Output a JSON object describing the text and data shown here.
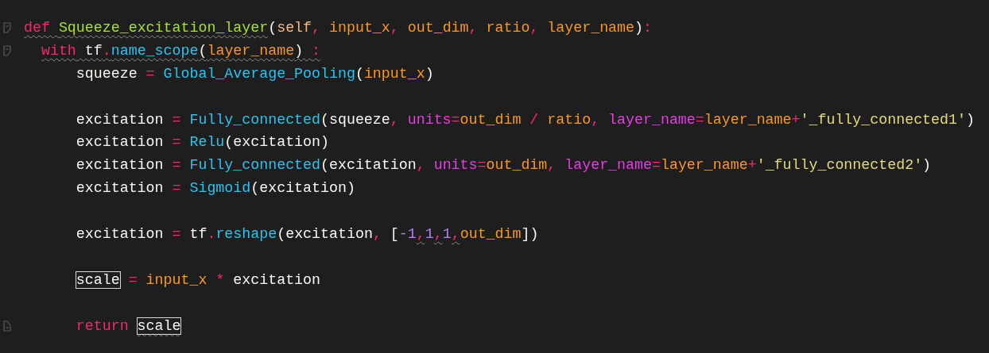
{
  "editor": {
    "lines": [
      {
        "kind": "code",
        "fold_start": true,
        "fold_end": false,
        "tokens": [
          {
            "text": "def ",
            "kind": "keyword",
            "squiggle": true,
            "boxed": false
          },
          {
            "text": "Squeeze_excitation_layer",
            "kind": "defname",
            "squiggle": true,
            "boxed": false
          },
          {
            "text": "(",
            "kind": "plain",
            "squiggle": false,
            "boxed": false
          },
          {
            "text": "self",
            "kind": "self",
            "squiggle": false,
            "boxed": false
          },
          {
            "text": ", ",
            "kind": "operator",
            "squiggle": false,
            "boxed": false
          },
          {
            "text": "input_x",
            "kind": "variable",
            "squiggle": false,
            "boxed": false
          },
          {
            "text": ", ",
            "kind": "operator",
            "squiggle": false,
            "boxed": false
          },
          {
            "text": "out_dim",
            "kind": "variable",
            "squiggle": false,
            "boxed": false
          },
          {
            "text": ", ",
            "kind": "operator",
            "squiggle": false,
            "boxed": false
          },
          {
            "text": "ratio",
            "kind": "variable",
            "squiggle": false,
            "boxed": false
          },
          {
            "text": ", ",
            "kind": "operator",
            "squiggle": false,
            "boxed": false
          },
          {
            "text": "layer_name",
            "kind": "variable",
            "squiggle": false,
            "boxed": false
          },
          {
            "text": ")",
            "kind": "plain",
            "squiggle": false,
            "boxed": false
          },
          {
            "text": ":",
            "kind": "operator",
            "squiggle": false,
            "boxed": false
          }
        ],
        "children": [
          {
            "kind": "code",
            "fold_start": true,
            "fold_end": false,
            "tokens": [
              {
                "text": "with",
                "kind": "keyword",
                "squiggle": true,
                "boxed": false
              },
              {
                "text": " tf",
                "kind": "plain",
                "squiggle": true,
                "boxed": false
              },
              {
                "text": ".",
                "kind": "operator",
                "squiggle": true,
                "boxed": false
              },
              {
                "text": "name_scope",
                "kind": "call",
                "squiggle": true,
                "boxed": false
              },
              {
                "text": "(",
                "kind": "plain",
                "squiggle": true,
                "boxed": false
              },
              {
                "text": "layer_name",
                "kind": "variable",
                "squiggle": true,
                "boxed": false
              },
              {
                "text": ") ",
                "kind": "plain",
                "squiggle": true,
                "boxed": false
              },
              {
                "text": ":",
                "kind": "operator",
                "squiggle": true,
                "boxed": false
              }
            ],
            "children": [
              {
                "kind": "code",
                "tokens": [
                  {
                    "text": "squeeze",
                    "kind": "plain",
                    "squiggle": false,
                    "boxed": false
                  },
                  {
                    "text": " = ",
                    "kind": "operator",
                    "squiggle": false,
                    "boxed": false
                  },
                  {
                    "text": "Global_Average_Pooling",
                    "kind": "call",
                    "squiggle": false,
                    "boxed": false
                  },
                  {
                    "text": "(",
                    "kind": "plain",
                    "squiggle": false,
                    "boxed": false
                  },
                  {
                    "text": "input_x",
                    "kind": "variable",
                    "squiggle": false,
                    "boxed": false
                  },
                  {
                    "text": ")",
                    "kind": "plain",
                    "squiggle": false,
                    "boxed": false
                  }
                ]
              },
              {
                "kind": "blank"
              },
              {
                "kind": "code",
                "tokens": [
                  {
                    "text": "excitation",
                    "kind": "plain",
                    "squiggle": false,
                    "boxed": false
                  },
                  {
                    "text": " = ",
                    "kind": "operator",
                    "squiggle": false,
                    "boxed": false
                  },
                  {
                    "text": "Fully_connected",
                    "kind": "call",
                    "squiggle": false,
                    "boxed": false
                  },
                  {
                    "text": "(squeeze",
                    "kind": "plain",
                    "squiggle": false,
                    "boxed": false
                  },
                  {
                    "text": ", ",
                    "kind": "operator",
                    "squiggle": false,
                    "boxed": false
                  },
                  {
                    "text": "units",
                    "kind": "kwarg",
                    "squiggle": false,
                    "boxed": false
                  },
                  {
                    "text": "=",
                    "kind": "operator",
                    "squiggle": false,
                    "boxed": false
                  },
                  {
                    "text": "out_dim",
                    "kind": "variable",
                    "squiggle": false,
                    "boxed": false
                  },
                  {
                    "text": " / ",
                    "kind": "operator",
                    "squiggle": false,
                    "boxed": false
                  },
                  {
                    "text": "ratio",
                    "kind": "variable",
                    "squiggle": false,
                    "boxed": false
                  },
                  {
                    "text": ", ",
                    "kind": "operator",
                    "squiggle": false,
                    "boxed": false
                  },
                  {
                    "text": "layer_name",
                    "kind": "kwarg",
                    "squiggle": false,
                    "boxed": false
                  },
                  {
                    "text": "=",
                    "kind": "operator",
                    "squiggle": false,
                    "boxed": false
                  },
                  {
                    "text": "layer_name",
                    "kind": "variable",
                    "squiggle": false,
                    "boxed": false
                  },
                  {
                    "text": "+",
                    "kind": "operator",
                    "squiggle": false,
                    "boxed": false
                  },
                  {
                    "text": "'_fully_connected1'",
                    "kind": "string",
                    "squiggle": false,
                    "boxed": false
                  },
                  {
                    "text": ")",
                    "kind": "plain",
                    "squiggle": false,
                    "boxed": false
                  }
                ]
              },
              {
                "kind": "code",
                "tokens": [
                  {
                    "text": "excitation",
                    "kind": "plain",
                    "squiggle": false,
                    "boxed": false
                  },
                  {
                    "text": " = ",
                    "kind": "operator",
                    "squiggle": false,
                    "boxed": false
                  },
                  {
                    "text": "Relu",
                    "kind": "call",
                    "squiggle": false,
                    "boxed": false
                  },
                  {
                    "text": "(excitation)",
                    "kind": "plain",
                    "squiggle": false,
                    "boxed": false
                  }
                ]
              },
              {
                "kind": "code",
                "tokens": [
                  {
                    "text": "excitation",
                    "kind": "plain",
                    "squiggle": false,
                    "boxed": false
                  },
                  {
                    "text": " = ",
                    "kind": "operator",
                    "squiggle": false,
                    "boxed": false
                  },
                  {
                    "text": "Fully_connected",
                    "kind": "call",
                    "squiggle": false,
                    "boxed": false
                  },
                  {
                    "text": "(excitation",
                    "kind": "plain",
                    "squiggle": false,
                    "boxed": false
                  },
                  {
                    "text": ", ",
                    "kind": "operator",
                    "squiggle": false,
                    "boxed": false
                  },
                  {
                    "text": "units",
                    "kind": "kwarg",
                    "squiggle": false,
                    "boxed": false
                  },
                  {
                    "text": "=",
                    "kind": "operator",
                    "squiggle": false,
                    "boxed": false
                  },
                  {
                    "text": "out_dim",
                    "kind": "variable",
                    "squiggle": false,
                    "boxed": false
                  },
                  {
                    "text": ", ",
                    "kind": "operator",
                    "squiggle": false,
                    "boxed": false
                  },
                  {
                    "text": "layer_name",
                    "kind": "kwarg",
                    "squiggle": false,
                    "boxed": false
                  },
                  {
                    "text": "=",
                    "kind": "operator",
                    "squiggle": false,
                    "boxed": false
                  },
                  {
                    "text": "layer_name",
                    "kind": "variable",
                    "squiggle": false,
                    "boxed": false
                  },
                  {
                    "text": "+",
                    "kind": "operator",
                    "squiggle": false,
                    "boxed": false
                  },
                  {
                    "text": "'_fully_connected2'",
                    "kind": "string",
                    "squiggle": false,
                    "boxed": false
                  },
                  {
                    "text": ")",
                    "kind": "plain",
                    "squiggle": false,
                    "boxed": false
                  }
                ]
              },
              {
                "kind": "code",
                "tokens": [
                  {
                    "text": "excitation",
                    "kind": "plain",
                    "squiggle": false,
                    "boxed": false
                  },
                  {
                    "text": " = ",
                    "kind": "operator",
                    "squiggle": false,
                    "boxed": false
                  },
                  {
                    "text": "Sigmoid",
                    "kind": "call",
                    "squiggle": false,
                    "boxed": false
                  },
                  {
                    "text": "(excitation)",
                    "kind": "plain",
                    "squiggle": false,
                    "boxed": false
                  }
                ]
              },
              {
                "kind": "blank"
              },
              {
                "kind": "code",
                "tokens": [
                  {
                    "text": "excitation",
                    "kind": "plain",
                    "squiggle": false,
                    "boxed": false
                  },
                  {
                    "text": " = ",
                    "kind": "operator",
                    "squiggle": false,
                    "boxed": false
                  },
                  {
                    "text": "tf",
                    "kind": "plain",
                    "squiggle": false,
                    "boxed": false
                  },
                  {
                    "text": ".",
                    "kind": "operator",
                    "squiggle": false,
                    "boxed": false
                  },
                  {
                    "text": "reshape",
                    "kind": "call",
                    "squiggle": false,
                    "boxed": false
                  },
                  {
                    "text": "(excitation",
                    "kind": "plain",
                    "squiggle": false,
                    "boxed": false
                  },
                  {
                    "text": ", ",
                    "kind": "operator",
                    "squiggle": false,
                    "boxed": false
                  },
                  {
                    "text": "[",
                    "kind": "plain",
                    "squiggle": false,
                    "boxed": false
                  },
                  {
                    "text": "-1",
                    "kind": "number",
                    "squiggle": false,
                    "boxed": false
                  },
                  {
                    "text": ",",
                    "kind": "operator",
                    "squiggle": true,
                    "boxed": false
                  },
                  {
                    "text": "1",
                    "kind": "number",
                    "squiggle": false,
                    "boxed": false
                  },
                  {
                    "text": ",",
                    "kind": "operator",
                    "squiggle": true,
                    "boxed": false
                  },
                  {
                    "text": "1",
                    "kind": "number",
                    "squiggle": false,
                    "boxed": false
                  },
                  {
                    "text": ",",
                    "kind": "operator",
                    "squiggle": true,
                    "boxed": false
                  },
                  {
                    "text": "out_dim",
                    "kind": "variable",
                    "squiggle": false,
                    "boxed": false
                  },
                  {
                    "text": "])",
                    "kind": "plain",
                    "squiggle": false,
                    "boxed": false
                  }
                ]
              },
              {
                "kind": "blank"
              },
              {
                "kind": "code",
                "tokens": [
                  {
                    "text": "scale",
                    "kind": "plain",
                    "squiggle": false,
                    "boxed": true
                  },
                  {
                    "text": " = ",
                    "kind": "operator",
                    "squiggle": false,
                    "boxed": false
                  },
                  {
                    "text": "input_x",
                    "kind": "variable",
                    "squiggle": false,
                    "boxed": false
                  },
                  {
                    "text": " * ",
                    "kind": "operator",
                    "squiggle": false,
                    "boxed": false
                  },
                  {
                    "text": "excitation",
                    "kind": "plain",
                    "squiggle": false,
                    "boxed": false
                  }
                ]
              },
              {
                "kind": "blank"
              },
              {
                "kind": "code",
                "fold_start": false,
                "fold_end": true,
                "tokens": [
                  {
                    "text": "return ",
                    "kind": "keyword",
                    "squiggle": false,
                    "boxed": false
                  },
                  {
                    "text": "scale",
                    "kind": "plain",
                    "squiggle": true,
                    "boxed": true
                  }
                ]
              }
            ]
          }
        ]
      }
    ]
  }
}
